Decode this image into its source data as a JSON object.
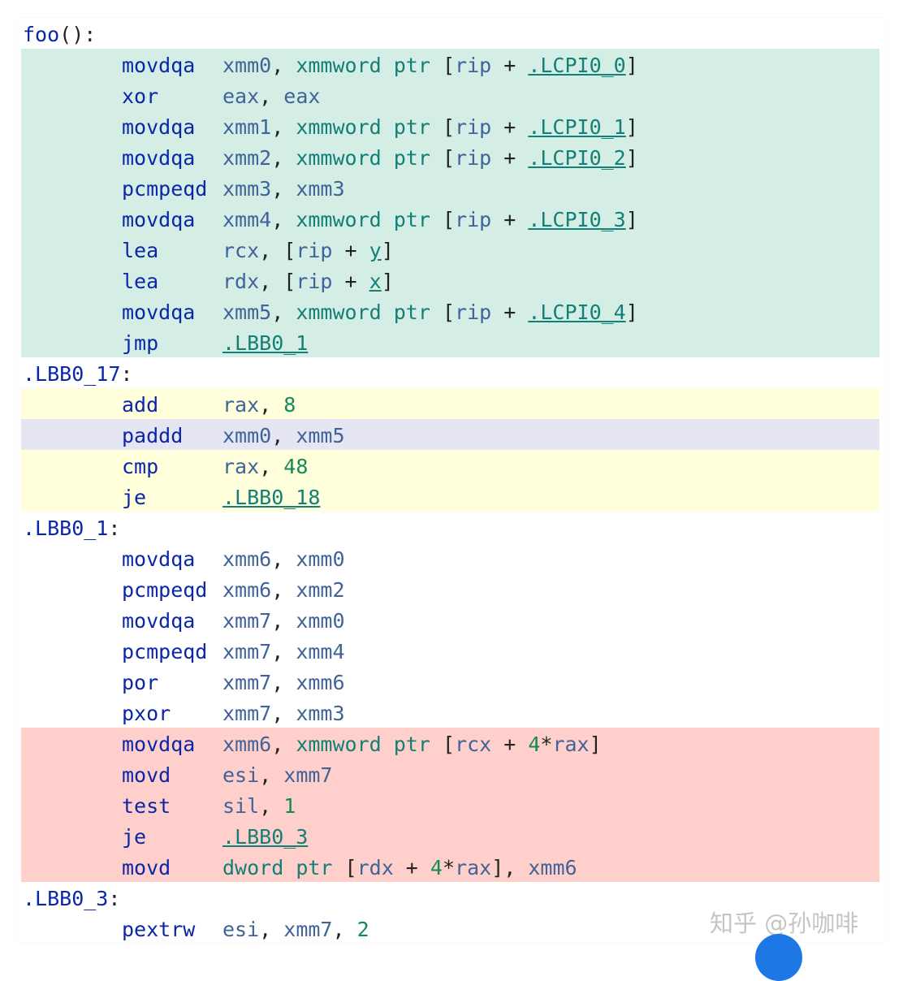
{
  "watermark": "知乎 @孙咖啡",
  "lines": [
    {
      "band": "none",
      "label": "foo",
      "label_suffix": "():",
      "ins": "",
      "ops": []
    },
    {
      "band": "green",
      "label": "",
      "ins": "movdqa",
      "ops": [
        {
          "t": "xmm0",
          "k": "reg"
        },
        {
          "t": ", ",
          "k": "punct"
        },
        {
          "t": "xmmword",
          "k": "kw"
        },
        {
          "t": " ",
          "k": "punct"
        },
        {
          "t": "ptr",
          "k": "kw"
        },
        {
          "t": " [",
          "k": "punct"
        },
        {
          "t": "rip",
          "k": "reg"
        },
        {
          "t": " + ",
          "k": "punct"
        },
        {
          "t": ".LCPI0_0",
          "k": "ref"
        },
        {
          "t": "]",
          "k": "punct"
        }
      ]
    },
    {
      "band": "green",
      "label": "",
      "ins": "xor",
      "ops": [
        {
          "t": "eax",
          "k": "reg"
        },
        {
          "t": ", ",
          "k": "punct"
        },
        {
          "t": "eax",
          "k": "reg"
        }
      ]
    },
    {
      "band": "green",
      "label": "",
      "ins": "movdqa",
      "ops": [
        {
          "t": "xmm1",
          "k": "reg"
        },
        {
          "t": ", ",
          "k": "punct"
        },
        {
          "t": "xmmword",
          "k": "kw"
        },
        {
          "t": " ",
          "k": "punct"
        },
        {
          "t": "ptr",
          "k": "kw"
        },
        {
          "t": " [",
          "k": "punct"
        },
        {
          "t": "rip",
          "k": "reg"
        },
        {
          "t": " + ",
          "k": "punct"
        },
        {
          "t": ".LCPI0_1",
          "k": "ref"
        },
        {
          "t": "]",
          "k": "punct"
        }
      ]
    },
    {
      "band": "green",
      "label": "",
      "ins": "movdqa",
      "ops": [
        {
          "t": "xmm2",
          "k": "reg"
        },
        {
          "t": ", ",
          "k": "punct"
        },
        {
          "t": "xmmword",
          "k": "kw"
        },
        {
          "t": " ",
          "k": "punct"
        },
        {
          "t": "ptr",
          "k": "kw"
        },
        {
          "t": " [",
          "k": "punct"
        },
        {
          "t": "rip",
          "k": "reg"
        },
        {
          "t": " + ",
          "k": "punct"
        },
        {
          "t": ".LCPI0_2",
          "k": "ref"
        },
        {
          "t": "]",
          "k": "punct"
        }
      ]
    },
    {
      "band": "green",
      "label": "",
      "ins": "pcmpeqd",
      "ops": [
        {
          "t": "xmm3",
          "k": "reg"
        },
        {
          "t": ", ",
          "k": "punct"
        },
        {
          "t": "xmm3",
          "k": "reg"
        }
      ]
    },
    {
      "band": "green",
      "label": "",
      "ins": "movdqa",
      "ops": [
        {
          "t": "xmm4",
          "k": "reg"
        },
        {
          "t": ", ",
          "k": "punct"
        },
        {
          "t": "xmmword",
          "k": "kw"
        },
        {
          "t": " ",
          "k": "punct"
        },
        {
          "t": "ptr",
          "k": "kw"
        },
        {
          "t": " [",
          "k": "punct"
        },
        {
          "t": "rip",
          "k": "reg"
        },
        {
          "t": " + ",
          "k": "punct"
        },
        {
          "t": ".LCPI0_3",
          "k": "ref"
        },
        {
          "t": "]",
          "k": "punct"
        }
      ]
    },
    {
      "band": "green",
      "label": "",
      "ins": "lea",
      "ops": [
        {
          "t": "rcx",
          "k": "reg"
        },
        {
          "t": ", [",
          "k": "punct"
        },
        {
          "t": "rip",
          "k": "reg"
        },
        {
          "t": " + ",
          "k": "punct"
        },
        {
          "t": "y",
          "k": "ref"
        },
        {
          "t": "]",
          "k": "punct"
        }
      ]
    },
    {
      "band": "green",
      "label": "",
      "ins": "lea",
      "ops": [
        {
          "t": "rdx",
          "k": "reg"
        },
        {
          "t": ", [",
          "k": "punct"
        },
        {
          "t": "rip",
          "k": "reg"
        },
        {
          "t": " + ",
          "k": "punct"
        },
        {
          "t": "x",
          "k": "ref"
        },
        {
          "t": "]",
          "k": "punct"
        }
      ]
    },
    {
      "band": "green",
      "label": "",
      "ins": "movdqa",
      "ops": [
        {
          "t": "xmm5",
          "k": "reg"
        },
        {
          "t": ", ",
          "k": "punct"
        },
        {
          "t": "xmmword",
          "k": "kw"
        },
        {
          "t": " ",
          "k": "punct"
        },
        {
          "t": "ptr",
          "k": "kw"
        },
        {
          "t": " [",
          "k": "punct"
        },
        {
          "t": "rip",
          "k": "reg"
        },
        {
          "t": " + ",
          "k": "punct"
        },
        {
          "t": ".LCPI0_4",
          "k": "ref"
        },
        {
          "t": "]",
          "k": "punct"
        }
      ]
    },
    {
      "band": "green",
      "label": "",
      "ins": "jmp",
      "ops": [
        {
          "t": ".LBB0_1",
          "k": "ref"
        }
      ]
    },
    {
      "band": "none",
      "label": ".LBB0_17",
      "label_suffix": ":",
      "ins": "",
      "ops": []
    },
    {
      "band": "yellow",
      "label": "",
      "ins": "add",
      "ops": [
        {
          "t": "rax",
          "k": "reg"
        },
        {
          "t": ", ",
          "k": "punct"
        },
        {
          "t": "8",
          "k": "num"
        }
      ]
    },
    {
      "band": "purple",
      "label": "",
      "ins": "paddd",
      "ops": [
        {
          "t": "xmm0",
          "k": "reg"
        },
        {
          "t": ", ",
          "k": "punct"
        },
        {
          "t": "xmm5",
          "k": "reg"
        }
      ]
    },
    {
      "band": "yellow",
      "label": "",
      "ins": "cmp",
      "ops": [
        {
          "t": "rax",
          "k": "reg"
        },
        {
          "t": ", ",
          "k": "punct"
        },
        {
          "t": "48",
          "k": "num"
        }
      ]
    },
    {
      "band": "yellow",
      "label": "",
      "ins": "je",
      "ops": [
        {
          "t": ".LBB0_18",
          "k": "ref"
        }
      ]
    },
    {
      "band": "none",
      "label": ".LBB0_1",
      "label_suffix": ":",
      "ins": "",
      "ops": []
    },
    {
      "band": "none",
      "label": "",
      "ins": "movdqa",
      "ops": [
        {
          "t": "xmm6",
          "k": "reg"
        },
        {
          "t": ", ",
          "k": "punct"
        },
        {
          "t": "xmm0",
          "k": "reg"
        }
      ]
    },
    {
      "band": "none",
      "label": "",
      "ins": "pcmpeqd",
      "ops": [
        {
          "t": "xmm6",
          "k": "reg"
        },
        {
          "t": ", ",
          "k": "punct"
        },
        {
          "t": "xmm2",
          "k": "reg"
        }
      ]
    },
    {
      "band": "none",
      "label": "",
      "ins": "movdqa",
      "ops": [
        {
          "t": "xmm7",
          "k": "reg"
        },
        {
          "t": ", ",
          "k": "punct"
        },
        {
          "t": "xmm0",
          "k": "reg"
        }
      ]
    },
    {
      "band": "none",
      "label": "",
      "ins": "pcmpeqd",
      "ops": [
        {
          "t": "xmm7",
          "k": "reg"
        },
        {
          "t": ", ",
          "k": "punct"
        },
        {
          "t": "xmm4",
          "k": "reg"
        }
      ]
    },
    {
      "band": "none",
      "label": "",
      "ins": "por",
      "ops": [
        {
          "t": "xmm7",
          "k": "reg"
        },
        {
          "t": ", ",
          "k": "punct"
        },
        {
          "t": "xmm6",
          "k": "reg"
        }
      ]
    },
    {
      "band": "none",
      "label": "",
      "ins": "pxor",
      "ops": [
        {
          "t": "xmm7",
          "k": "reg"
        },
        {
          "t": ", ",
          "k": "punct"
        },
        {
          "t": "xmm3",
          "k": "reg"
        }
      ]
    },
    {
      "band": "red",
      "label": "",
      "ins": "movdqa",
      "ops": [
        {
          "t": "xmm6",
          "k": "reg"
        },
        {
          "t": ", ",
          "k": "punct"
        },
        {
          "t": "xmmword",
          "k": "kw"
        },
        {
          "t": " ",
          "k": "punct"
        },
        {
          "t": "ptr",
          "k": "kw"
        },
        {
          "t": " [",
          "k": "punct"
        },
        {
          "t": "rcx",
          "k": "reg"
        },
        {
          "t": " + ",
          "k": "punct"
        },
        {
          "t": "4",
          "k": "num"
        },
        {
          "t": "*",
          "k": "punct"
        },
        {
          "t": "rax",
          "k": "reg"
        },
        {
          "t": "]",
          "k": "punct"
        }
      ]
    },
    {
      "band": "red",
      "label": "",
      "ins": "movd",
      "ops": [
        {
          "t": "esi",
          "k": "reg"
        },
        {
          "t": ", ",
          "k": "punct"
        },
        {
          "t": "xmm7",
          "k": "reg"
        }
      ]
    },
    {
      "band": "red",
      "label": "",
      "ins": "test",
      "ops": [
        {
          "t": "sil",
          "k": "reg"
        },
        {
          "t": ", ",
          "k": "punct"
        },
        {
          "t": "1",
          "k": "num"
        }
      ]
    },
    {
      "band": "red",
      "label": "",
      "ins": "je",
      "ops": [
        {
          "t": ".LBB0_3",
          "k": "ref"
        }
      ]
    },
    {
      "band": "red",
      "label": "",
      "ins": "movd",
      "ops": [
        {
          "t": "dword",
          "k": "kw"
        },
        {
          "t": " ",
          "k": "punct"
        },
        {
          "t": "ptr",
          "k": "kw"
        },
        {
          "t": " [",
          "k": "punct"
        },
        {
          "t": "rdx",
          "k": "reg"
        },
        {
          "t": " + ",
          "k": "punct"
        },
        {
          "t": "4",
          "k": "num"
        },
        {
          "t": "*",
          "k": "punct"
        },
        {
          "t": "rax",
          "k": "reg"
        },
        {
          "t": "], ",
          "k": "punct"
        },
        {
          "t": "xmm6",
          "k": "reg"
        }
      ]
    },
    {
      "band": "none",
      "label": ".LBB0_3",
      "label_suffix": ":",
      "ins": "",
      "ops": []
    },
    {
      "band": "none",
      "label": "",
      "ins": "pextrw",
      "ops": [
        {
          "t": "esi",
          "k": "reg"
        },
        {
          "t": ", ",
          "k": "punct"
        },
        {
          "t": "xmm7",
          "k": "reg"
        },
        {
          "t": ", ",
          "k": "punct"
        },
        {
          "t": "2",
          "k": "num"
        }
      ]
    }
  ]
}
